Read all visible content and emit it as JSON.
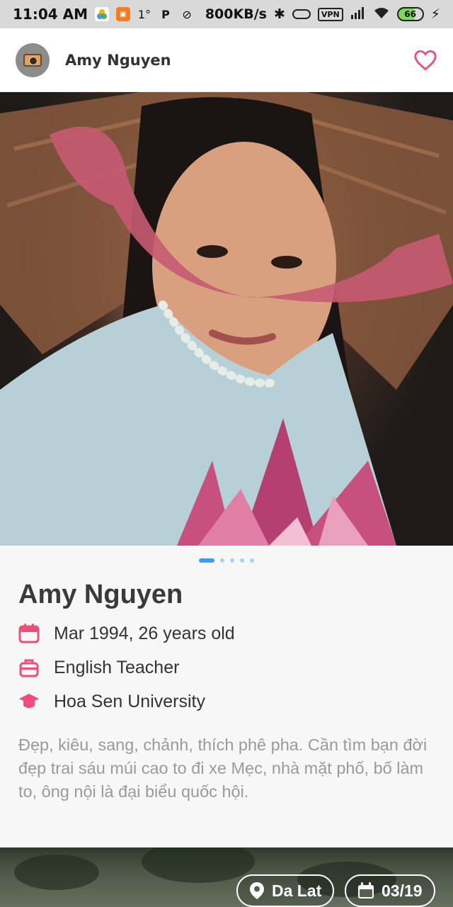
{
  "status_bar": {
    "time": "11:04 AM",
    "speed": "800KB/s",
    "vpn": "VPN",
    "battery": "66"
  },
  "header": {
    "name": "Amy Nguyen"
  },
  "photo": {
    "pages": 5,
    "active_page": 1
  },
  "profile": {
    "name": "Amy Nguyen",
    "birth": "Mar 1994, 26 years old",
    "job": "English Teacher",
    "school": "Hoa Sen University",
    "bio": "Đẹp, kiêu, sang, chảnh, thích phê pha. Cần tìm bạn đời đẹp trai sáu múi cao to đi xe Mẹc, nhà mặt phố, bố làm to, ông nội là đại biểu quốc hội."
  },
  "next_card": {
    "location": "Da Lat",
    "date": "03/19"
  },
  "colors": {
    "accent": "#ef4d7a",
    "dot_active": "#3b9cf2",
    "dot_inactive": "#a8cff5"
  }
}
